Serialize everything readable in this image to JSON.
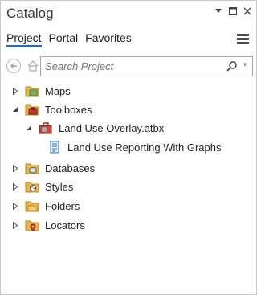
{
  "window": {
    "title": "Catalog"
  },
  "tabs": [
    {
      "label": "Project",
      "active": true
    },
    {
      "label": "Portal",
      "active": false
    },
    {
      "label": "Favorites",
      "active": false
    }
  ],
  "search": {
    "placeholder": "Search Project",
    "value": ""
  },
  "tree": {
    "maps": "Maps",
    "toolboxes": "Toolboxes",
    "toolbox_file": "Land Use Overlay.atbx",
    "model": "Land Use Reporting With Graphs",
    "databases": "Databases",
    "styles": "Styles",
    "folders": "Folders",
    "locators": "Locators"
  },
  "colors": {
    "accent": "#2b6cb0",
    "folder": "#e8b84a",
    "border": "#c9c9c9"
  }
}
